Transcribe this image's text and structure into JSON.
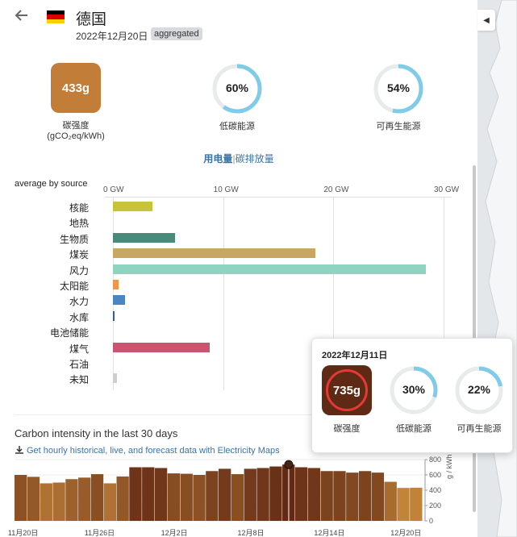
{
  "header": {
    "zone_name": "德国",
    "date": "2022年12月20日",
    "badge": "aggregated",
    "flag_colors": [
      "#000000",
      "#dd0000",
      "#ffce00"
    ]
  },
  "metrics": {
    "carbon_intensity": {
      "value": "433g",
      "label": "碳强度",
      "unit": "(gCO₂eq/kWh)",
      "color": "#c27d38"
    },
    "low_carbon": {
      "value": "60%",
      "label": "低碳能源",
      "fraction": 0.6
    },
    "renewable": {
      "value": "54%",
      "label": "可再生能源",
      "fraction": 0.54
    }
  },
  "toggle": {
    "active": "用电量",
    "separator": "|",
    "inactive": "碳排放量"
  },
  "chart_data": {
    "type": "bar",
    "orientation": "horizontal",
    "title": "average by source",
    "x_ticks": [
      "0 GW",
      "10 GW",
      "20 GW",
      "30 GW"
    ],
    "xlim": [
      0,
      30
    ],
    "categories": [
      "核能",
      "地热",
      "生物质",
      "煤炭",
      "风力",
      "太阳能",
      "水力",
      "水库",
      "电池储能",
      "煤气",
      "石油",
      "未知"
    ],
    "values": [
      3.6,
      0,
      5.6,
      18.4,
      28.4,
      0.5,
      1.1,
      0.1,
      0,
      8.8,
      0,
      0.4
    ],
    "colors": [
      "#c8c43a",
      "#cccccc",
      "#4b8a7a",
      "#c9a662",
      "#8fd3c1",
      "#f0964a",
      "#4a86c1",
      "#2f5f9f",
      "#999999",
      "#c9566f",
      "#777777",
      "#cfcfcf"
    ]
  },
  "history": {
    "title": "Carbon intensity in the last 30 days",
    "link": "Get hourly historical, live, and forecast data with Electricity Maps",
    "y_ticks": [
      "800",
      "600",
      "400",
      "200",
      "0"
    ],
    "y_label": "g / kWh",
    "x_ticks": [
      "11月20日",
      "11月26日",
      "12月2日",
      "12月8日",
      "12月14日",
      "12月20日"
    ],
    "values": [
      600,
      575,
      490,
      500,
      545,
      565,
      610,
      490,
      580,
      700,
      700,
      690,
      620,
      615,
      600,
      650,
      680,
      610,
      680,
      690,
      710,
      735,
      700,
      690,
      650,
      650,
      630,
      650,
      630,
      510,
      430,
      433
    ],
    "selected_index": 21
  },
  "tooltip": {
    "date": "2022年12月11日",
    "intensity": "735g",
    "intensity_label": "碳强度",
    "low_carbon": "30%",
    "low_carbon_label": "低碳能源",
    "low_carbon_fraction": 0.3,
    "renewable": "22%",
    "renewable_label": "可再生能源",
    "renewable_fraction": 0.22
  }
}
